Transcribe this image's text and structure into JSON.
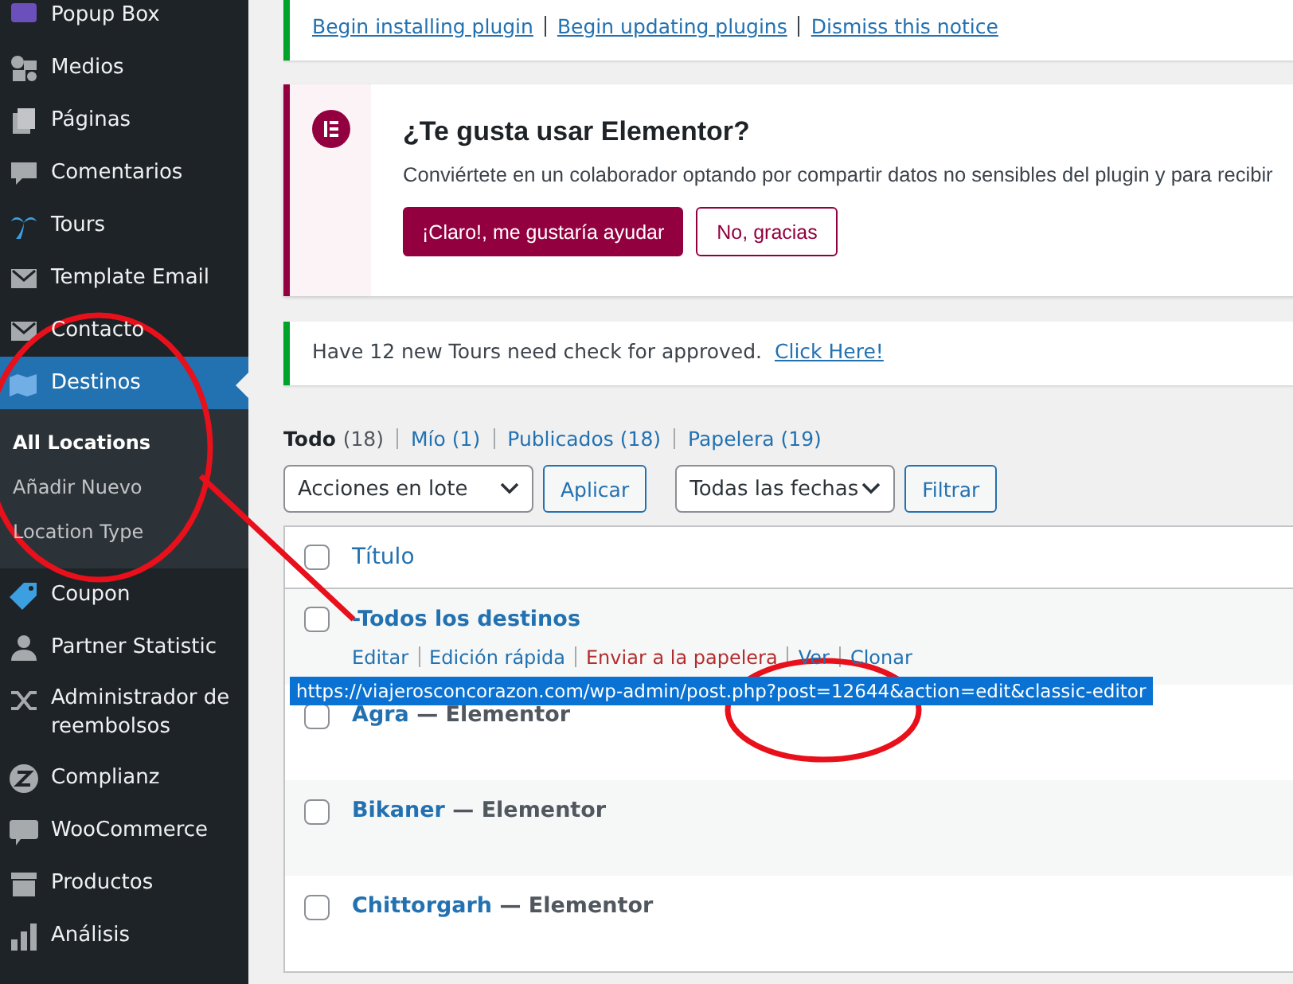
{
  "sidebar": {
    "items": [
      {
        "label": "Popup Box",
        "selected": false
      },
      {
        "label": "Medios",
        "selected": false
      },
      {
        "label": "Páginas",
        "selected": false
      },
      {
        "label": "Comentarios",
        "selected": false
      },
      {
        "label": "Tours",
        "selected": false
      },
      {
        "label": "Template Email",
        "selected": false
      },
      {
        "label": "Contacto",
        "selected": false
      },
      {
        "label": "Destinos",
        "selected": true,
        "children": [
          {
            "label": "All Locations",
            "selected": true
          },
          {
            "label": "Añadir Nuevo",
            "selected": false
          },
          {
            "label": "Location Type",
            "selected": false
          }
        ]
      },
      {
        "label": "Coupon",
        "selected": false
      },
      {
        "label": "Partner Statistic",
        "selected": false
      },
      {
        "label": "Administrador de reembolsos",
        "selected": false
      },
      {
        "label": "Complianz",
        "selected": false
      },
      {
        "label": "WooCommerce",
        "selected": false
      },
      {
        "label": "Productos",
        "selected": false
      },
      {
        "label": "Análisis",
        "selected": false
      }
    ]
  },
  "plugin_notice": {
    "links": [
      "Begin installing plugin",
      "Begin updating plugins",
      "Dismiss this notice"
    ]
  },
  "elementor_notice": {
    "title": "¿Te gusta usar Elementor?",
    "text": "Conviértete en un colaborador optando por compartir datos no sensibles del plugin y para recibir",
    "buttons": [
      {
        "label": "¡Claro!, me gustaría ayudar",
        "primary": true
      },
      {
        "label": "No, gracias",
        "primary": false
      }
    ]
  },
  "tours_notice": {
    "text": "Have 12 new Tours need check for approved.",
    "link": "Click Here!"
  },
  "views": [
    {
      "label": "Todo",
      "count": "(18)",
      "selected": true
    },
    {
      "label": "Mío",
      "count": "(1)",
      "selected": false
    },
    {
      "label": "Publicados",
      "count": "(18)",
      "selected": false
    },
    {
      "label": "Papelera",
      "count": "(19)",
      "selected": false
    }
  ],
  "filters": {
    "bulk_select": "Acciones en lote",
    "apply": "Aplicar",
    "date_select": "Todas las fechas",
    "filter": "Filtrar"
  },
  "table": {
    "columns": [
      "Título"
    ],
    "all_checked": false,
    "rows": [
      {
        "title": "-Todos los destinos",
        "checked": false,
        "actions": [
          {
            "label": "Editar",
            "danger": false
          },
          {
            "label": "Edición rápida",
            "danger": false
          },
          {
            "label": "Enviar a la papelera",
            "danger": true
          },
          {
            "label": "Ver",
            "danger": false
          },
          {
            "label": "Clonar",
            "danger": false
          }
        ]
      },
      {
        "title": "Agra",
        "state": "— Elementor",
        "checked": false
      },
      {
        "title": "Bikaner",
        "state": "— Elementor",
        "checked": false
      },
      {
        "title": "Chittorgarh",
        "state": "— Elementor",
        "checked": false
      }
    ]
  },
  "link_tooltip": "https://viajerosconcorazon.com/wp-admin/post.php?post=12644&action=edit&classic-editor"
}
